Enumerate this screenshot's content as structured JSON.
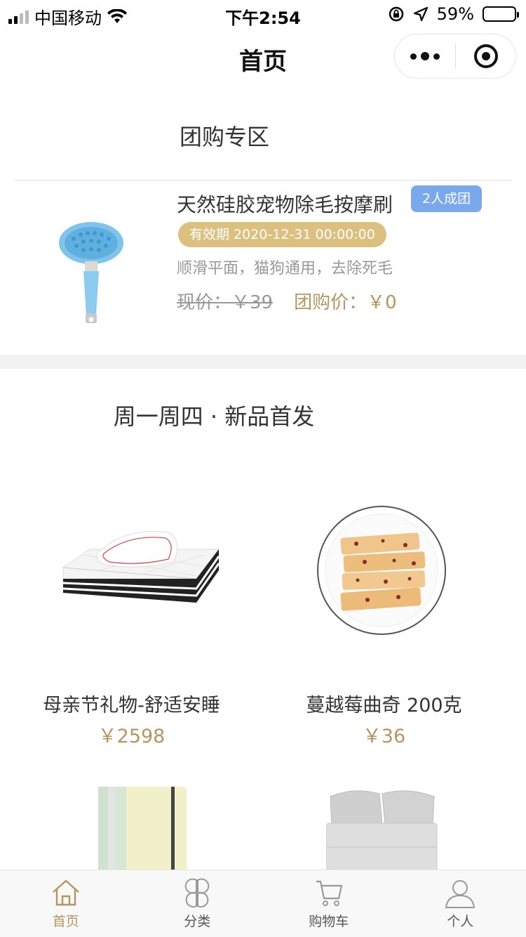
{
  "status_bar": {
    "carrier": "中国移动",
    "time": "下午2:54",
    "battery": "59%",
    "battery_level": 0.59
  },
  "nav": {
    "title": "首页"
  },
  "group_buy": {
    "section_title": "团购专区",
    "item": {
      "name": "天然硅胶宠物除毛按摩刷",
      "badge": "2人成团",
      "validity": "有效期 2020-12-31 00:00:00",
      "description": "顺滑平面，猫狗通用，去除死毛",
      "current_price": "现价：￥39",
      "group_price": "团购价：￥0"
    }
  },
  "new_products": {
    "section_title": "周一周四 · 新品首发",
    "items": [
      {
        "name": "母亲节礼物-舒适安睡",
        "price": "￥2598"
      },
      {
        "name": "蔓越莓曲奇 200克",
        "price": "￥36"
      }
    ]
  },
  "tab_bar": {
    "tabs": [
      {
        "label": "首页",
        "icon": "home-icon",
        "active": true
      },
      {
        "label": "分类",
        "icon": "category-icon",
        "active": false
      },
      {
        "label": "购物车",
        "icon": "cart-icon",
        "active": false
      },
      {
        "label": "个人",
        "icon": "person-icon",
        "active": false
      }
    ]
  },
  "colors": {
    "accent": "#b39660",
    "badge_blue": "#7aa8ec",
    "validity_gold": "#dcc080"
  }
}
